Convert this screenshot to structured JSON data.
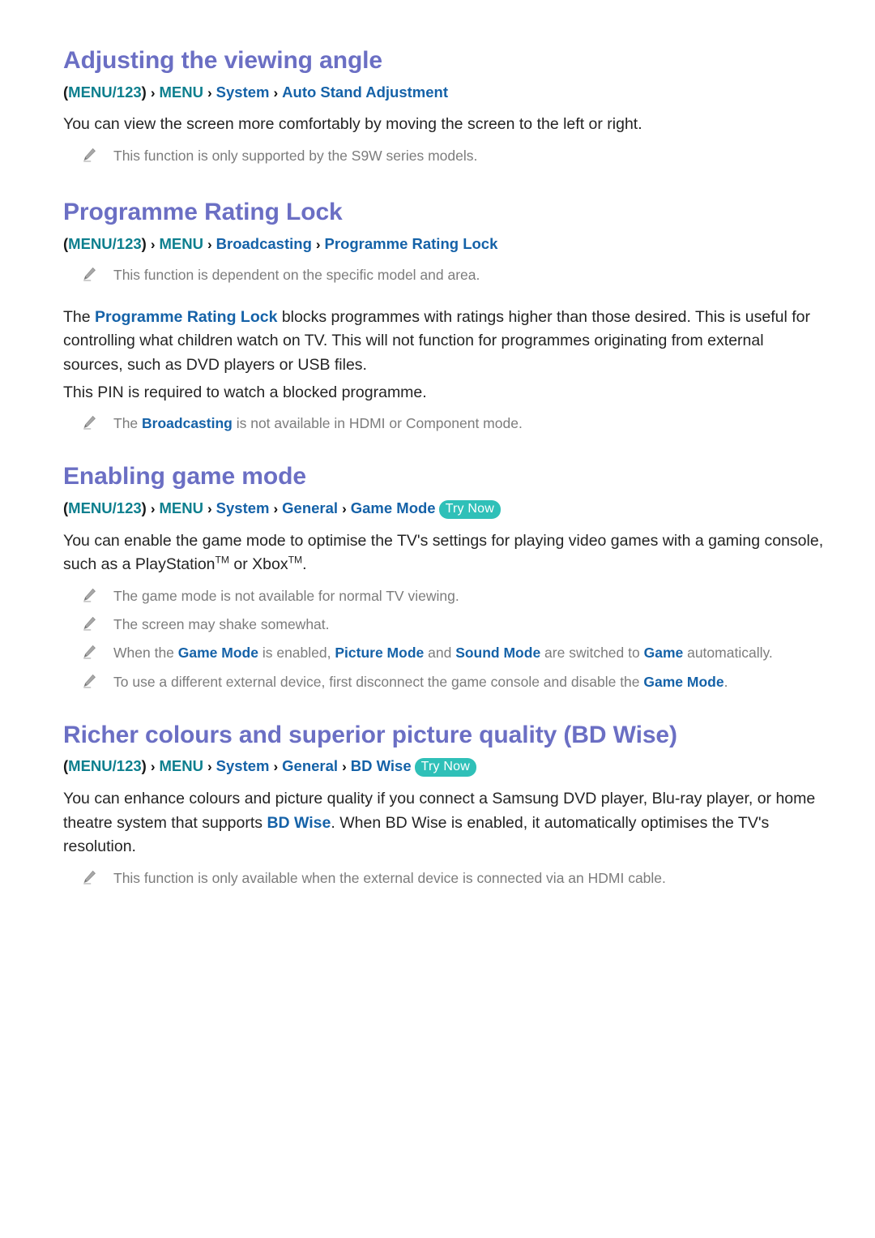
{
  "document": {
    "type": "tv-e-manual-page"
  },
  "colors": {
    "heading": "#6b6fc4",
    "crumb_teal": "#0d7f8e",
    "crumb_blue": "#1562a8",
    "try_now_badge": "#2fc0b8",
    "note_text": "#7c7c7c",
    "body_text": "#242424"
  },
  "icons": {
    "note": "pencil-icon",
    "separator": "chevron-right-icon"
  },
  "sections": [
    {
      "title": "Adjusting the viewing angle",
      "breadcrumb": {
        "open_paren": "(",
        "close_paren": ")",
        "first": "MENU/123",
        "separator": "›",
        "items": [
          "MENU",
          "System",
          "Auto Stand Adjustment"
        ],
        "try_now": null
      },
      "paragraphs": [
        "You can view the screen more comfortably by moving the screen to the left or right."
      ],
      "notes": [
        "This function is only supported by the S9W series models."
      ]
    },
    {
      "title": "Programme Rating Lock",
      "breadcrumb": {
        "open_paren": "(",
        "close_paren": ")",
        "first": "MENU/123",
        "separator": "›",
        "items": [
          "MENU",
          "Broadcasting",
          "Programme Rating Lock"
        ],
        "try_now": null
      },
      "notes_top": [
        "This function is dependent on the specific model and area."
      ],
      "paragraphs": [
        "The Programme Rating Lock blocks programmes with ratings higher than those desired. This is useful for controlling what children watch on TV. This will not function for programmes originating from external sources, such as DVD players or USB files.",
        "This PIN is required to watch a blocked programme."
      ],
      "paragraph_links": [
        "Programme Rating Lock"
      ],
      "notes": [
        "The Broadcasting is not available in HDMI or Component mode."
      ],
      "note_links": [
        "Broadcasting"
      ]
    },
    {
      "title": "Enabling game mode",
      "breadcrumb": {
        "open_paren": "(",
        "close_paren": ")",
        "first": "MENU/123",
        "separator": "›",
        "items": [
          "MENU",
          "System",
          "General",
          "Game Mode"
        ],
        "try_now": "Try Now"
      },
      "paragraphs": [
        "You can enable the game mode to optimise the TV's settings for playing video games with a gaming console, such as a PlayStation™ or Xbox™."
      ],
      "paragraph_parts": {
        "lead": "You can enable the game mode to optimise the TV's settings for playing video games with a gaming console, such as a PlayStation",
        "tm1": "TM",
        "middle": " or Xbox",
        "tm2": "TM",
        "tail": "."
      },
      "notes": [
        "The game mode is not available for normal TV viewing.",
        "The screen may shake somewhat.",
        "When the Game Mode is enabled, Picture Mode and Sound Mode are switched to Game automatically.",
        "To use a different external device, first disconnect the game console and disable the Game Mode."
      ],
      "note_parts": {
        "note3": {
          "a": "When the ",
          "link1": "Game Mode",
          "b": " is enabled, ",
          "link2": "Picture Mode",
          "c": " and ",
          "link3": "Sound Mode",
          "d": " are switched to ",
          "link4": "Game",
          "e": " automatically."
        },
        "note4": {
          "a": "To use a different external device, first disconnect the game console and disable the ",
          "link1": "Game Mode",
          "b": "."
        }
      }
    },
    {
      "title": "Richer colours and superior picture quality (BD Wise)",
      "breadcrumb": {
        "open_paren": "(",
        "close_paren": ")",
        "first": "MENU/123",
        "separator": "›",
        "items": [
          "MENU",
          "System",
          "General",
          "BD Wise"
        ],
        "try_now": "Try Now"
      },
      "paragraphs": [
        "You can enhance colours and picture quality if you connect a Samsung DVD player, Blu-ray player, or home theatre system that supports BD Wise. When BD Wise is enabled, it automatically optimises the TV's resolution."
      ],
      "paragraph_parts": {
        "a": "You can enhance colours and picture quality if you connect a Samsung DVD player, Blu-ray player, or home theatre system that supports ",
        "link1": "BD Wise",
        "b": ". When BD Wise is enabled, it automatically optimises the TV's resolution."
      },
      "notes": [
        "This function is only available when the external device is connected via an HDMI cable."
      ]
    }
  ]
}
